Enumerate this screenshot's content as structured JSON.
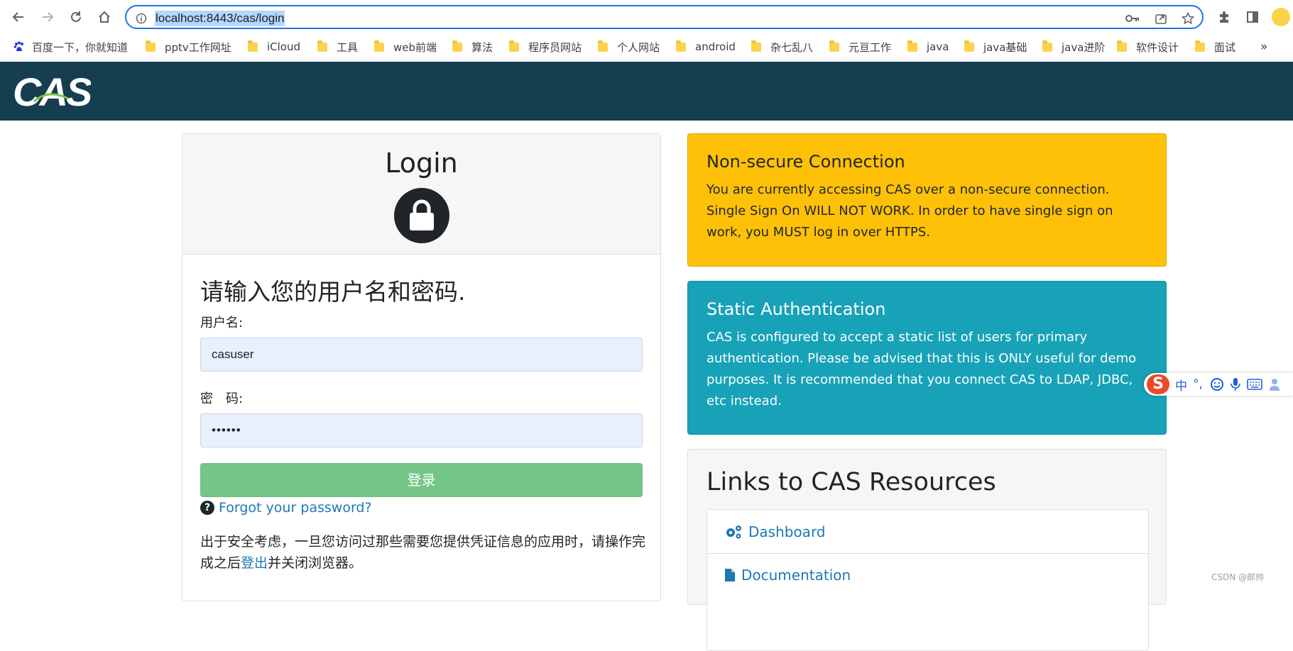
{
  "browser": {
    "url": "localhost:8443/cas/login",
    "bookmarks": [
      {
        "label": "百度一下，你就知道",
        "icon": "baidu-paw-icon"
      },
      {
        "label": "pptv工作网址",
        "icon": "folder-icon"
      },
      {
        "label": "iCloud",
        "icon": "folder-icon"
      },
      {
        "label": "工具",
        "icon": "folder-icon"
      },
      {
        "label": "web前端",
        "icon": "folder-icon"
      },
      {
        "label": "算法",
        "icon": "folder-icon"
      },
      {
        "label": "程序员网站",
        "icon": "folder-icon"
      },
      {
        "label": "个人网站",
        "icon": "folder-icon"
      },
      {
        "label": "android",
        "icon": "folder-icon"
      },
      {
        "label": "杂七乱八",
        "icon": "folder-icon"
      },
      {
        "label": "元亘工作",
        "icon": "folder-icon"
      },
      {
        "label": "java",
        "icon": "folder-icon"
      },
      {
        "label": "java基础",
        "icon": "folder-icon"
      },
      {
        "label": "java进阶",
        "icon": "folder-icon"
      },
      {
        "label": "软件设计",
        "icon": "folder-icon"
      },
      {
        "label": "面试",
        "icon": "folder-icon"
      }
    ],
    "overflow_label": "»",
    "accent": "#1a73e8"
  },
  "header": {
    "logo_text": "CAS",
    "background": "#153e50"
  },
  "login": {
    "title": "Login",
    "prompt": "请输入您的用户名和密码.",
    "username_label": "用户名:",
    "username_value": "casuser",
    "password_label": "密　码:",
    "password_value": "••••••",
    "submit_label": "登录",
    "forgot_label": "Forgot your password?",
    "security_note_before": "出于安全考虑，一旦您访问过那些需要您提供凭证信息的应用时，请操作完成之后",
    "security_note_link": "登出",
    "security_note_after": "并关闭浏览器。"
  },
  "notices": {
    "warning": {
      "title": "Non-secure Connection",
      "body": "You are currently accessing CAS over a non-secure connection. Single Sign On WILL NOT WORK. In order to have single sign on work, you MUST log in over HTTPS.",
      "color": "#ffc107"
    },
    "info": {
      "title": "Static Authentication",
      "body": "CAS is configured to accept a static list of users for primary authentication. Please be advised that this is ONLY useful for demo purposes. It is recommended that you connect CAS to LDAP, JDBC, etc instead.",
      "color": "#17a2b8"
    }
  },
  "resources": {
    "title": "Links to CAS Resources",
    "links": [
      {
        "label": "Dashboard",
        "icon": "gears-icon"
      },
      {
        "label": "Documentation",
        "icon": "document-icon"
      }
    ]
  },
  "ime": {
    "logo": "S",
    "items": [
      "中",
      "°,"
    ]
  },
  "watermark": "CSDN @郎帅"
}
